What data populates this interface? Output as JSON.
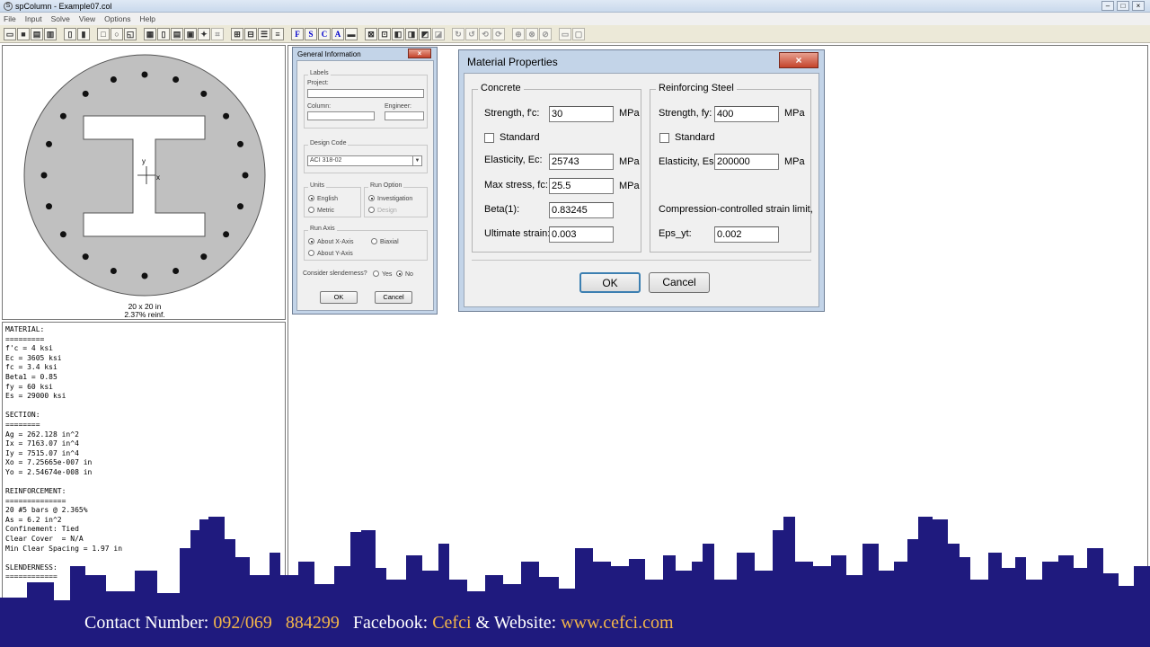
{
  "window": {
    "title": "spColumn - Example07.col",
    "min_label": "–",
    "max_label": "□",
    "close_label": "×"
  },
  "menu": [
    "File",
    "Input",
    "Solve",
    "View",
    "Options",
    "Help"
  ],
  "toolbar": {
    "icons": [
      "open-icon",
      "save-icon",
      "print-icon",
      "print-preview-icon",
      "page-icon",
      "page2-icon",
      "rect-section-icon",
      "circle-section-icon",
      "irregular-section-icon",
      "grid1-icon",
      "grid2-icon",
      "grid3-icon",
      "grid4-icon",
      "grid5-icon",
      "pointer-icon",
      "zoom-icon",
      "align1-icon",
      "align2-icon",
      "align3-icon",
      "align4-icon",
      "align5-icon"
    ],
    "letters": [
      "F",
      "S",
      "C",
      "A"
    ],
    "accent": "#0000cc"
  },
  "section_view": {
    "caption_line1": "20 x 20 in",
    "caption_line2": "2.37% reinf.",
    "axis_y": "y",
    "axis_x": "x",
    "fill_color": "#c0c0c0"
  },
  "results": {
    "lines": [
      "MATERIAL:",
      "=========",
      "f'c = 4 ksi",
      "Ec = 3605 ksi",
      "fc = 3.4 ksi",
      "Beta1 = 0.85",
      "fy = 60 ksi",
      "Es = 29000 ksi",
      "",
      "SECTION:",
      "========",
      "Ag = 262.128 in^2",
      "Ix = 7163.07 in^4",
      "Iy = 7515.07 in^4",
      "Xo = 7.25665e-007 in",
      "Yo = 2.54674e-008 in",
      "",
      "REINFORCEMENT:",
      "==============",
      "20 #5 bars @ 2.365%",
      "As = 6.2 in^2",
      "Confinement: Tied",
      "Clear Cover  = N/A",
      "Min Clear Spacing = 1.97 in",
      "",
      "SLENDERNESS:",
      "============"
    ]
  },
  "general_info": {
    "title": "General Information",
    "labels_group": "Labels",
    "project_label": "Project:",
    "project_value": "",
    "column_label": "Column:",
    "column_value": "",
    "engineer_label": "Engineer:",
    "engineer_value": "",
    "design_code_group": "Design Code",
    "design_code_value": "ACI 318-02",
    "units_group": "Units",
    "units_english": "English",
    "units_metric": "Metric",
    "run_option_group": "Run Option",
    "run_investigation": "Investigation",
    "run_design": "Design",
    "run_axis_group": "Run Axis",
    "axis_x": "About X-Axis",
    "axis_biaxial": "Biaxial",
    "axis_y": "About Y-Axis",
    "slenderness_label": "Consider slenderness?",
    "slenderness_yes": "Yes",
    "slenderness_no": "No",
    "ok_label": "OK",
    "cancel_label": "Cancel"
  },
  "material_props": {
    "title": "Material Properties",
    "concrete": {
      "legend": "Concrete",
      "strength_label": "Strength, f'c:",
      "strength_value": "30",
      "strength_unit": "MPa",
      "standard_label": "Standard",
      "elasticity_label": "Elasticity, Ec:",
      "elasticity_value": "25743",
      "elasticity_unit": "MPa",
      "max_stress_label": "Max stress, fc:",
      "max_stress_value": "25.5",
      "max_stress_unit": "MPa",
      "beta_label": "Beta(1):",
      "beta_value": "0.83245",
      "ult_strain_label": "Ultimate strain:",
      "ult_strain_value": "0.003"
    },
    "steel": {
      "legend": "Reinforcing Steel",
      "strength_label": "Strength, fy:",
      "strength_value": "400",
      "strength_unit": "MPa",
      "standard_label": "Standard",
      "elasticity_label": "Elasticity, Es:",
      "elasticity_value": "200000",
      "elasticity_unit": "MPa",
      "ccsl_label": "Compression-controlled strain limit,",
      "eps_label": "Eps_yt:",
      "eps_value": "0.002"
    },
    "ok_label": "OK",
    "cancel_label": "Cancel"
  },
  "overlay": {
    "contact_label": "Contact Number:",
    "phone": "092/069   884299",
    "facebook_label": "Facebook:",
    "facebook_value": "Cefci",
    "website_label": "& Website:",
    "website_value": "www.cefci.com",
    "bg_color": "#1f1a7e",
    "highlight_color": "#f2b54a"
  }
}
